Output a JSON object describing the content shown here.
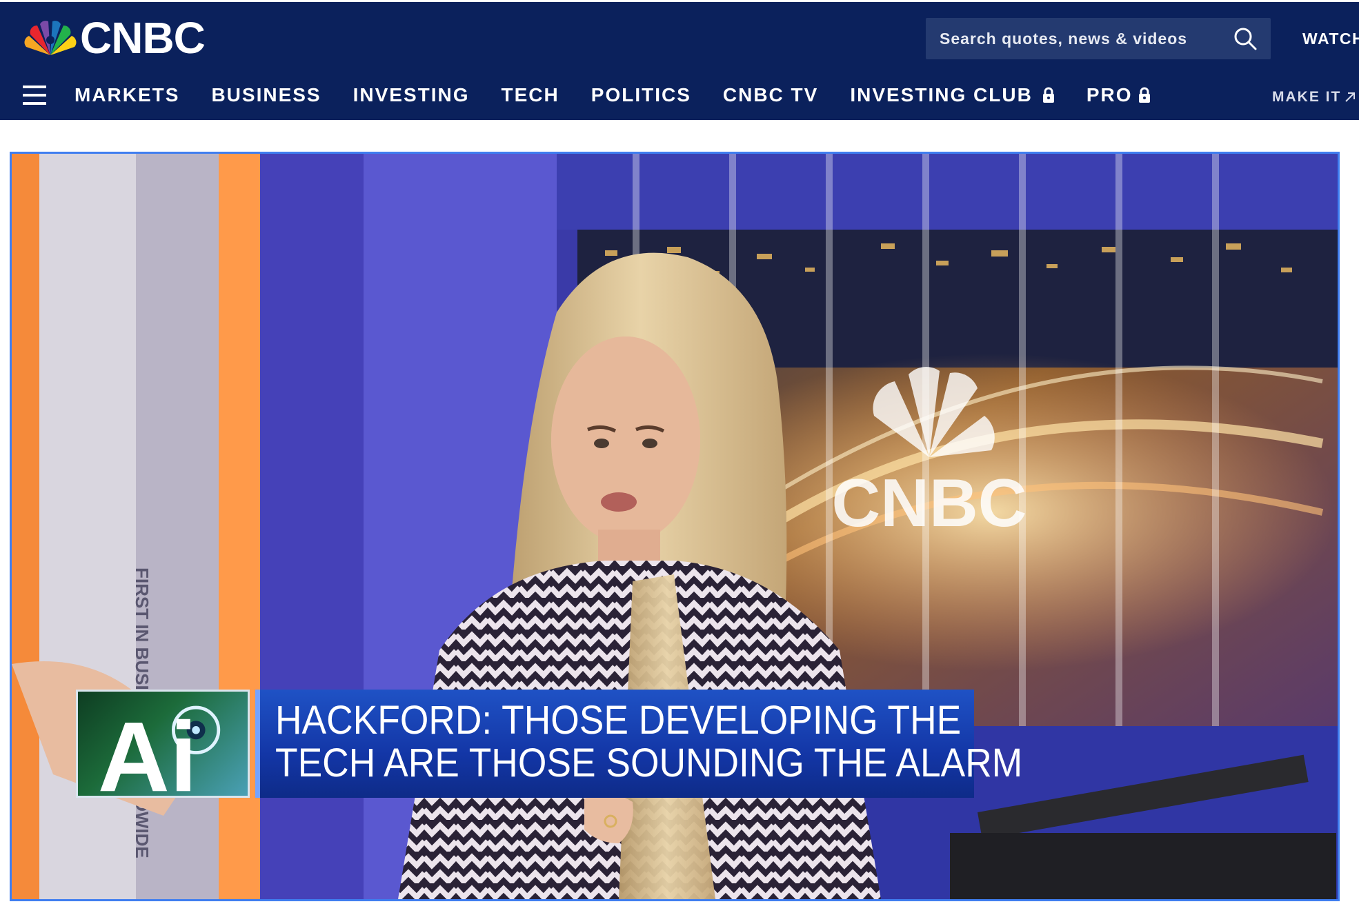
{
  "header": {
    "logo_text": "CNBC",
    "search_placeholder": "Search quotes, news & videos",
    "watch_label": "WATCH",
    "make_it_label": "MAKE IT"
  },
  "nav": {
    "items": [
      {
        "label": "MARKETS",
        "locked": false
      },
      {
        "label": "BUSINESS",
        "locked": false
      },
      {
        "label": "INVESTING",
        "locked": false
      },
      {
        "label": "TECH",
        "locked": false
      },
      {
        "label": "POLITICS",
        "locked": false
      },
      {
        "label": "CNBC TV",
        "locked": false
      },
      {
        "label": "INVESTING CLUB",
        "locked": true
      },
      {
        "label": "PRO",
        "locked": true
      }
    ]
  },
  "video": {
    "badge_text": "Ai",
    "headline_line1": "HACKFORD: THOSE DEVELOPING THE",
    "headline_line2": "TECH ARE THOSE SOUNDING THE ALARM",
    "studio_logo_text": "CNBC"
  },
  "colors": {
    "header_bg": "#0b215c",
    "search_bg": "#243a70",
    "video_border": "#3f7ef0",
    "caption_bg": "#1336a6"
  },
  "icons": {
    "search": "search-icon",
    "menu": "hamburger-menu-icon",
    "lock": "lock-icon",
    "external": "external-arrow-icon",
    "brand": "peacock-logo-icon"
  }
}
